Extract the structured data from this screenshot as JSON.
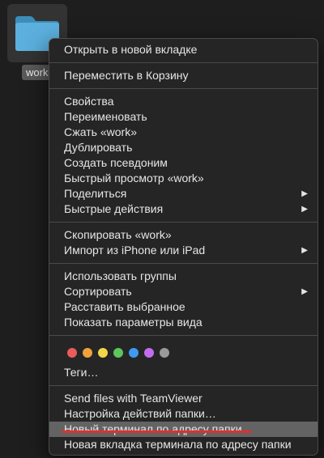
{
  "folder": {
    "label": "work",
    "icon": "folder-icon",
    "color": "#4fa3d1"
  },
  "menu": {
    "group1": [
      "Открыть в новой вкладке"
    ],
    "group2": [
      "Переместить в Корзину"
    ],
    "group3": [
      {
        "label": "Свойства",
        "submenu": false
      },
      {
        "label": "Переименовать",
        "submenu": false
      },
      {
        "label": "Сжать «work»",
        "submenu": false
      },
      {
        "label": "Дублировать",
        "submenu": false
      },
      {
        "label": "Создать псевдоним",
        "submenu": false
      },
      {
        "label": "Быстрый просмотр «work»",
        "submenu": false
      },
      {
        "label": "Поделиться",
        "submenu": true
      },
      {
        "label": "Быстрые действия",
        "submenu": true
      }
    ],
    "group4": [
      {
        "label": "Скопировать «work»",
        "submenu": false
      },
      {
        "label": "Импорт из iPhone или iPad",
        "submenu": true
      }
    ],
    "group5": [
      {
        "label": "Использовать группы",
        "submenu": false
      },
      {
        "label": "Сортировать",
        "submenu": true
      },
      {
        "label": "Расставить выбранное",
        "submenu": false
      },
      {
        "label": "Показать параметры вида",
        "submenu": false
      }
    ],
    "tag_colors": [
      "#ec5b5b",
      "#f0a33a",
      "#f3d548",
      "#5cc65c",
      "#3f9bf0",
      "#c26cf0",
      "#9a9a9a"
    ],
    "tags_label": "Теги…",
    "group7": [
      {
        "label": "Send files with TeamViewer",
        "highlight": false
      },
      {
        "label": "Настройка действий папки…",
        "highlight": false
      },
      {
        "label": "Новый терминал по адресу папки",
        "highlight": true
      },
      {
        "label": "Новая вкладка терминала по адресу папки",
        "highlight": false
      }
    ],
    "submenu_arrow": "▶",
    "annotation_color": "#e03030"
  }
}
